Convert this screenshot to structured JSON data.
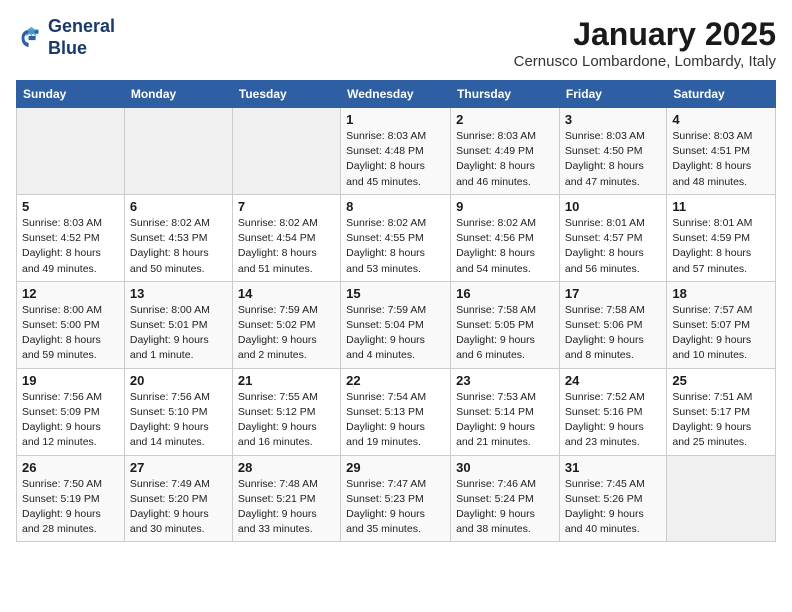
{
  "logo": {
    "line1": "General",
    "line2": "Blue"
  },
  "title": "January 2025",
  "subtitle": "Cernusco Lombardone, Lombardy, Italy",
  "headers": [
    "Sunday",
    "Monday",
    "Tuesday",
    "Wednesday",
    "Thursday",
    "Friday",
    "Saturday"
  ],
  "weeks": [
    [
      {
        "day": "",
        "info": ""
      },
      {
        "day": "",
        "info": ""
      },
      {
        "day": "",
        "info": ""
      },
      {
        "day": "1",
        "info": "Sunrise: 8:03 AM\nSunset: 4:48 PM\nDaylight: 8 hours\nand 45 minutes."
      },
      {
        "day": "2",
        "info": "Sunrise: 8:03 AM\nSunset: 4:49 PM\nDaylight: 8 hours\nand 46 minutes."
      },
      {
        "day": "3",
        "info": "Sunrise: 8:03 AM\nSunset: 4:50 PM\nDaylight: 8 hours\nand 47 minutes."
      },
      {
        "day": "4",
        "info": "Sunrise: 8:03 AM\nSunset: 4:51 PM\nDaylight: 8 hours\nand 48 minutes."
      }
    ],
    [
      {
        "day": "5",
        "info": "Sunrise: 8:03 AM\nSunset: 4:52 PM\nDaylight: 8 hours\nand 49 minutes."
      },
      {
        "day": "6",
        "info": "Sunrise: 8:02 AM\nSunset: 4:53 PM\nDaylight: 8 hours\nand 50 minutes."
      },
      {
        "day": "7",
        "info": "Sunrise: 8:02 AM\nSunset: 4:54 PM\nDaylight: 8 hours\nand 51 minutes."
      },
      {
        "day": "8",
        "info": "Sunrise: 8:02 AM\nSunset: 4:55 PM\nDaylight: 8 hours\nand 53 minutes."
      },
      {
        "day": "9",
        "info": "Sunrise: 8:02 AM\nSunset: 4:56 PM\nDaylight: 8 hours\nand 54 minutes."
      },
      {
        "day": "10",
        "info": "Sunrise: 8:01 AM\nSunset: 4:57 PM\nDaylight: 8 hours\nand 56 minutes."
      },
      {
        "day": "11",
        "info": "Sunrise: 8:01 AM\nSunset: 4:59 PM\nDaylight: 8 hours\nand 57 minutes."
      }
    ],
    [
      {
        "day": "12",
        "info": "Sunrise: 8:00 AM\nSunset: 5:00 PM\nDaylight: 8 hours\nand 59 minutes."
      },
      {
        "day": "13",
        "info": "Sunrise: 8:00 AM\nSunset: 5:01 PM\nDaylight: 9 hours\nand 1 minute."
      },
      {
        "day": "14",
        "info": "Sunrise: 7:59 AM\nSunset: 5:02 PM\nDaylight: 9 hours\nand 2 minutes."
      },
      {
        "day": "15",
        "info": "Sunrise: 7:59 AM\nSunset: 5:04 PM\nDaylight: 9 hours\nand 4 minutes."
      },
      {
        "day": "16",
        "info": "Sunrise: 7:58 AM\nSunset: 5:05 PM\nDaylight: 9 hours\nand 6 minutes."
      },
      {
        "day": "17",
        "info": "Sunrise: 7:58 AM\nSunset: 5:06 PM\nDaylight: 9 hours\nand 8 minutes."
      },
      {
        "day": "18",
        "info": "Sunrise: 7:57 AM\nSunset: 5:07 PM\nDaylight: 9 hours\nand 10 minutes."
      }
    ],
    [
      {
        "day": "19",
        "info": "Sunrise: 7:56 AM\nSunset: 5:09 PM\nDaylight: 9 hours\nand 12 minutes."
      },
      {
        "day": "20",
        "info": "Sunrise: 7:56 AM\nSunset: 5:10 PM\nDaylight: 9 hours\nand 14 minutes."
      },
      {
        "day": "21",
        "info": "Sunrise: 7:55 AM\nSunset: 5:12 PM\nDaylight: 9 hours\nand 16 minutes."
      },
      {
        "day": "22",
        "info": "Sunrise: 7:54 AM\nSunset: 5:13 PM\nDaylight: 9 hours\nand 19 minutes."
      },
      {
        "day": "23",
        "info": "Sunrise: 7:53 AM\nSunset: 5:14 PM\nDaylight: 9 hours\nand 21 minutes."
      },
      {
        "day": "24",
        "info": "Sunrise: 7:52 AM\nSunset: 5:16 PM\nDaylight: 9 hours\nand 23 minutes."
      },
      {
        "day": "25",
        "info": "Sunrise: 7:51 AM\nSunset: 5:17 PM\nDaylight: 9 hours\nand 25 minutes."
      }
    ],
    [
      {
        "day": "26",
        "info": "Sunrise: 7:50 AM\nSunset: 5:19 PM\nDaylight: 9 hours\nand 28 minutes."
      },
      {
        "day": "27",
        "info": "Sunrise: 7:49 AM\nSunset: 5:20 PM\nDaylight: 9 hours\nand 30 minutes."
      },
      {
        "day": "28",
        "info": "Sunrise: 7:48 AM\nSunset: 5:21 PM\nDaylight: 9 hours\nand 33 minutes."
      },
      {
        "day": "29",
        "info": "Sunrise: 7:47 AM\nSunset: 5:23 PM\nDaylight: 9 hours\nand 35 minutes."
      },
      {
        "day": "30",
        "info": "Sunrise: 7:46 AM\nSunset: 5:24 PM\nDaylight: 9 hours\nand 38 minutes."
      },
      {
        "day": "31",
        "info": "Sunrise: 7:45 AM\nSunset: 5:26 PM\nDaylight: 9 hours\nand 40 minutes."
      },
      {
        "day": "",
        "info": ""
      }
    ]
  ]
}
